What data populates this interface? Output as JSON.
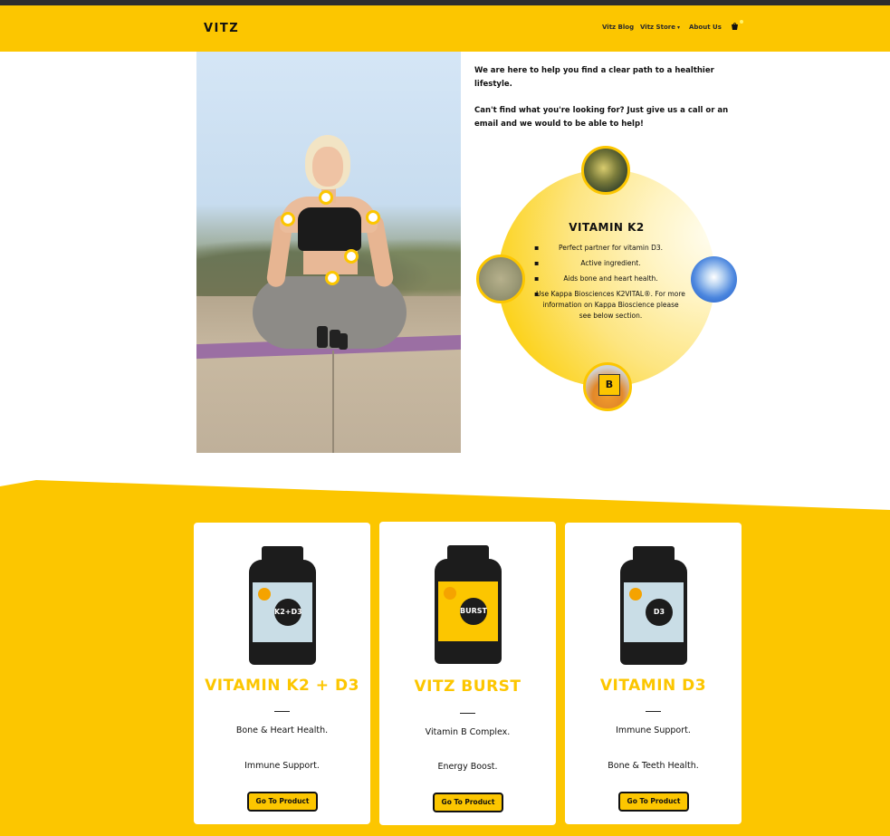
{
  "header": {
    "logo": "VITZ",
    "nav": [
      {
        "label": "Vitz Blog"
      },
      {
        "label": "Vitz Store"
      },
      {
        "label": "About Us"
      }
    ]
  },
  "intro": {
    "line1": "We are here to help you find a clear path to a healthier lifestyle.",
    "line2": "Can't find what you're looking for? Just give us a call or an email and we would to be able to help!"
  },
  "feature": {
    "title": "VITAMIN K2",
    "facts": [
      "Perfect partner for vitamin D3.",
      "Active ingredient.",
      "Aids bone and heart health.",
      "Use Kappa Biosciences K2VITAL®. For more information on Kappa Bioscience please see below section."
    ],
    "bubble_label": "B"
  },
  "products": [
    {
      "name": "VITAMIN K2 + D3",
      "jar_text": "K2+D3",
      "line1": "Bone & Heart Health.",
      "line2": "Immune Support.",
      "button": "Go To Product"
    },
    {
      "name": "VITZ BURST",
      "jar_text": "BURST",
      "line1": "Vitamin B Complex.",
      "line2": "Energy Boost.",
      "button": "Go To Product"
    },
    {
      "name": "VITAMIN D3",
      "jar_text": "D3",
      "line1": "Immune Support.",
      "line2": "Bone & Teeth Health.",
      "button": "Go To Product"
    }
  ],
  "colors": {
    "brand": "#fcc600",
    "dark": "#1c1c1c",
    "accent_blue": "#4b86de"
  }
}
